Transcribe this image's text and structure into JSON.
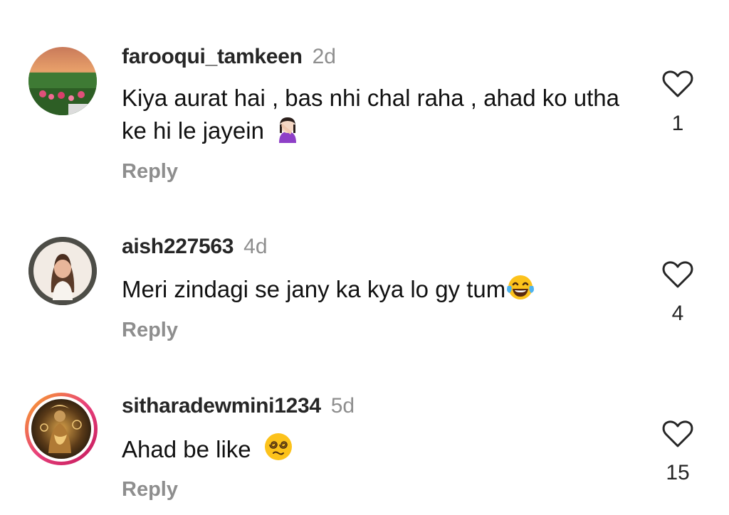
{
  "comments": [
    {
      "username": "farooqui_tamkeen",
      "time": "2d",
      "text": "Kiya aurat hai , bas nhi chal raha , ahad ko utha ke hi le jayein",
      "emoji": "woman-facepalming",
      "reply_label": "Reply",
      "likes": "1",
      "avatar": "landscape-photo"
    },
    {
      "username": "aish227563",
      "time": "4d",
      "text": "Meri zindagi se jany ka kya lo gy tum",
      "emoji": "face-with-tears-of-joy",
      "reply_label": "Reply",
      "likes": "4",
      "avatar": "illustrated-girl"
    },
    {
      "username": "sitharadewmini1234",
      "time": "5d",
      "text": "Ahad be like",
      "emoji": "face-with-spiral-eyes",
      "reply_label": "Reply",
      "likes": "15",
      "avatar": "golden-figure-art",
      "story_ring": true
    }
  ],
  "colors": {
    "username": "#262626",
    "meta": "#8e8e8e",
    "text": "#111111",
    "story_ring_start": "#f9a825",
    "story_ring_end": "#c2185b"
  }
}
